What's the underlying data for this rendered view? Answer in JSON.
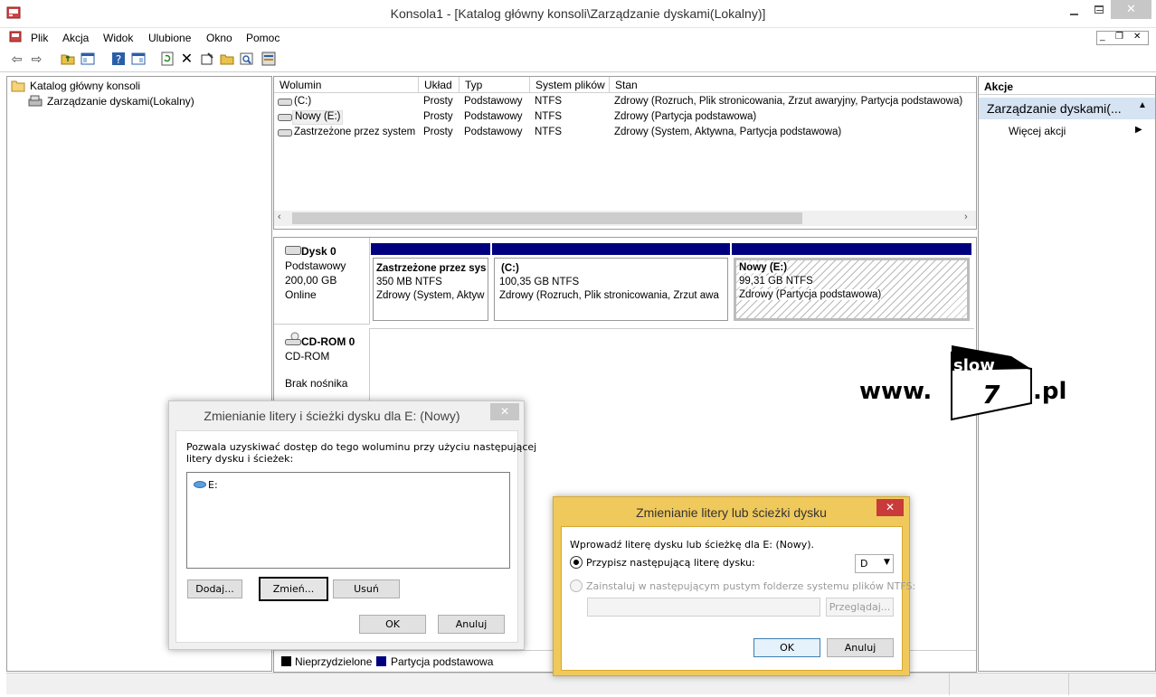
{
  "window": {
    "title": "Konsola1 - [Katalog główny konsoli\\Zarządzanie dyskami(Lokalny)]"
  },
  "menu": [
    "Plik",
    "Akcja",
    "Widok",
    "Ulubione",
    "Okno",
    "Pomoc"
  ],
  "toolbar_icons": [
    "back-icon",
    "forward-icon",
    "up-folder-icon",
    "show-tree-icon",
    "help-icon",
    "show-pane-icon",
    "refresh-icon",
    "delete-icon",
    "properties-icon",
    "open-icon",
    "search-icon",
    "settings-icon"
  ],
  "tree": {
    "root": "Katalog główny konsoli",
    "child": "Zarządzanie dyskami(Lokalny)"
  },
  "volumes": {
    "columns": [
      "Wolumin",
      "Układ",
      "Typ",
      "System plików",
      "Stan"
    ],
    "rows": [
      [
        "(C:)",
        "Prosty",
        "Podstawowy",
        "NTFS",
        "Zdrowy (Rozruch, Plik stronicowania, Zrzut awaryjny, Partycja podstawowa)"
      ],
      [
        "Nowy (E:)",
        "Prosty",
        "Podstawowy",
        "NTFS",
        "Zdrowy (Partycja podstawowa)"
      ],
      [
        "Zastrzeżone przez system",
        "Prosty",
        "Podstawowy",
        "NTFS",
        "Zdrowy (System, Aktywna, Partycja podstawowa)"
      ]
    ]
  },
  "disk0": {
    "name": "Dysk 0",
    "type": "Podstawowy",
    "size": "200,00 GB",
    "status": "Online",
    "partitions": [
      {
        "name": "Zastrzeżone przez sys",
        "size": "350 MB NTFS",
        "status": "Zdrowy (System, Aktyw"
      },
      {
        "name": "(C:)",
        "size": "100,35 GB NTFS",
        "status": "Zdrowy (Rozruch, Plik stronicowania, Zrzut awa"
      },
      {
        "name": "Nowy  (E:)",
        "size": "99,31 GB NTFS",
        "status": "Zdrowy (Partycja podstawowa)"
      }
    ]
  },
  "cdrom": {
    "name": "CD-ROM 0",
    "type": "CD-ROM",
    "status": "Brak nośnika"
  },
  "legend": [
    "Nieprzydzielone",
    "Partycja podstawowa"
  ],
  "actions": {
    "header": "Akcje",
    "section": "Zarządzanie dyskami(...",
    "more": "Więcej akcji"
  },
  "watermark": {
    "prefix": "www.",
    "word": "slow",
    "digit": "7",
    "suffix": ".pl"
  },
  "dialog1": {
    "title": "Zmienianie litery i ścieżki dysku dla E: (Nowy)",
    "description_line1": "Pozwala uzyskiwać dostęp do tego woluminu przy użyciu następującej",
    "description_line2": "litery dysku i ścieżek:",
    "list_item": "E:",
    "add": "Dodaj...",
    "change": "Zmień...",
    "remove": "Usuń",
    "ok": "OK",
    "cancel": "Anuluj"
  },
  "dialog2": {
    "title": "Zmienianie litery lub ścieżki dysku",
    "prompt": "Wprowadź literę dysku lub ścieżkę dla E: (Nowy).",
    "option1": "Przypisz następującą literę dysku:",
    "drive_letter": "D",
    "option2": "Zainstaluj w następującym pustym folderze systemu plików NTFS:",
    "browse": "Przeglądaj...",
    "ok": "OK",
    "cancel": "Anuluj"
  },
  "colors": {
    "partition_blue": "#00007f",
    "dialog2_border": "#f0c95c"
  }
}
